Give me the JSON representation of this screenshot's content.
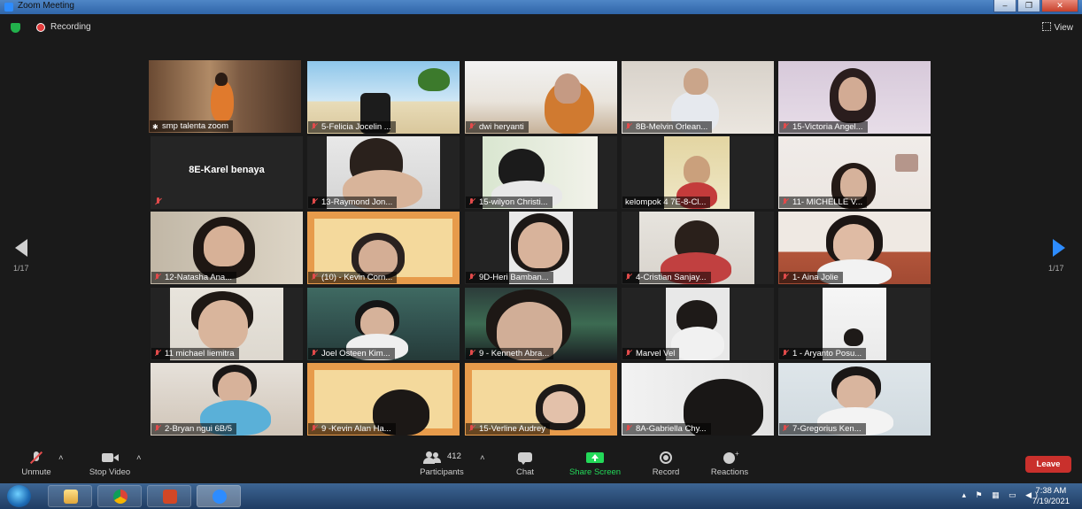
{
  "window": {
    "title": "Zoom Meeting",
    "controls": [
      "–",
      "❐",
      "✕"
    ]
  },
  "topbar": {
    "recording_label": "Recording",
    "view_label": "View"
  },
  "paging": {
    "left": "1/17",
    "right": "1/17"
  },
  "participants": [
    "smp talenta zoom",
    "5-Felicia Jocelin ...",
    "dwi heryanti",
    "8B-Melvin Orlean...",
    "15-Victoria Angel...",
    "8E-Karel benaya",
    "13-Raymond Jon...",
    "15-wilyon Christi...",
    "kelompok 4 7E-8-Cl...",
    "11- MICHELLE V...",
    "12-Natasha Ana...",
    "(10) - Kevin Corn...",
    "9D-Heri Bamban...",
    "4-Cristian Sanjay...",
    "1- Aina Jolie",
    "11 michael liemitra",
    "Joel Osteen Kim...",
    "9 - Kenneth Abra...",
    "Marvel Vel",
    "1 - Aryanto Posu...",
    "2-Bryan ngui 6B/5",
    "9 -Kevin Alan Ha...",
    "15-Verline Audrey",
    "8A-Gabriella Chy...",
    "7-Gregorius Ken..."
  ],
  "toolbar": {
    "unmute": "Unmute",
    "stop_video": "Stop Video",
    "participants": "Participants",
    "participants_count": "412",
    "chat": "Chat",
    "share_screen": "Share Screen",
    "record": "Record",
    "reactions": "Reactions",
    "leave": "Leave"
  },
  "taskbar": {
    "time": "7:38 AM",
    "date": "7/19/2021"
  },
  "colors": {
    "active_border": "#d7e33a",
    "share_green": "#23d959",
    "leave_red": "#c9302c",
    "muted_red": "#e24b4b"
  }
}
